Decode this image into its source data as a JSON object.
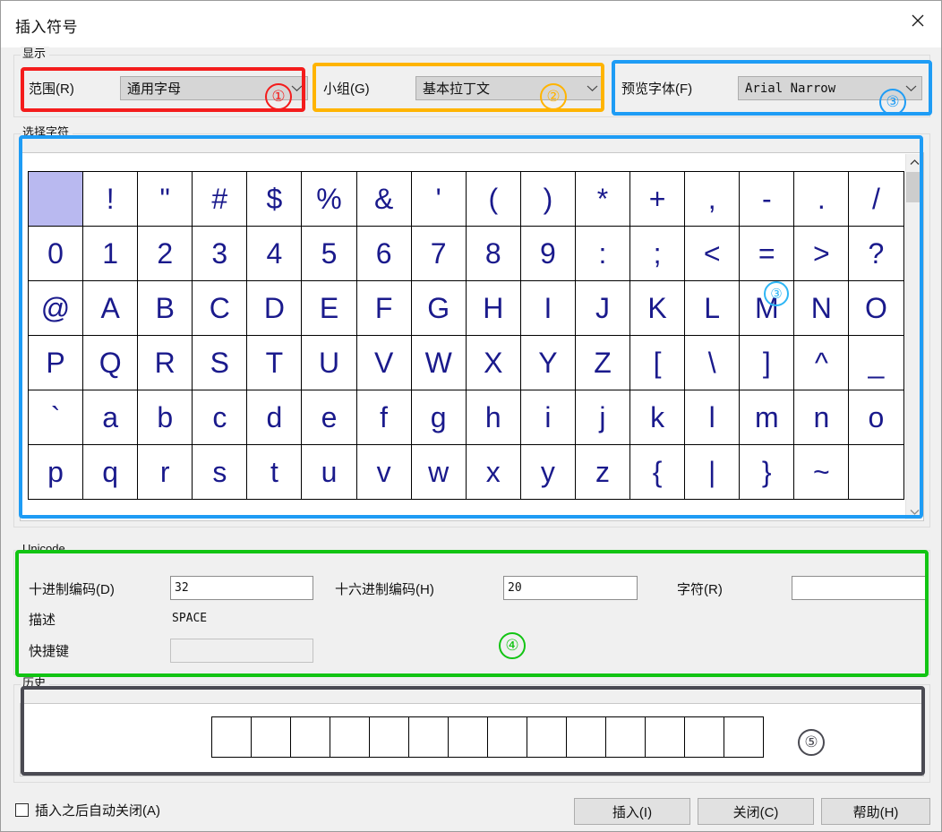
{
  "window": {
    "title": "插入符号",
    "close_icon": "close-icon"
  },
  "display_group": {
    "legend": "显示",
    "range_label": "范围(R)",
    "range_value": "通用字母",
    "subset_label": "小组(G)",
    "subset_value": "基本拉丁文",
    "font_label": "预览字体(F)",
    "font_value": "Arial Narrow"
  },
  "char_select_group": {
    "legend": "选择字符",
    "columns": 16,
    "selected_index": 0,
    "rows": [
      [
        " ",
        "!",
        "\"",
        "#",
        "$",
        "%",
        "&",
        "'",
        "(",
        ")",
        "*",
        "+",
        ",",
        "-",
        ".",
        "/"
      ],
      [
        "0",
        "1",
        "2",
        "3",
        "4",
        "5",
        "6",
        "7",
        "8",
        "9",
        ":",
        ";",
        "<",
        "=",
        ">",
        "?"
      ],
      [
        "@",
        "A",
        "B",
        "C",
        "D",
        "E",
        "F",
        "G",
        "H",
        "I",
        "J",
        "K",
        "L",
        "M",
        "N",
        "O"
      ],
      [
        "P",
        "Q",
        "R",
        "S",
        "T",
        "U",
        "V",
        "W",
        "X",
        "Y",
        "Z",
        "[",
        "\\",
        "]",
        "^",
        "_"
      ],
      [
        "`",
        "a",
        "b",
        "c",
        "d",
        "e",
        "f",
        "g",
        "h",
        "i",
        "j",
        "k",
        "l",
        "m",
        "n",
        "o"
      ],
      [
        "p",
        "q",
        "r",
        "s",
        "t",
        "u",
        "v",
        "w",
        "x",
        "y",
        "z",
        "{",
        "|",
        "}",
        "~",
        " "
      ]
    ],
    "scrollbar": {
      "up_icon": "chevron-up-icon",
      "down_icon": "chevron-down-icon"
    }
  },
  "unicode_group": {
    "legend": "Unicode",
    "decimal_label": "十进制编码(D)",
    "decimal_value": "32",
    "hex_label": "十六进制编码(H)",
    "hex_value": "20",
    "char_label": "字符(R)",
    "char_value": "",
    "description_label": "描述",
    "description_value": "SPACE",
    "shortcut_label": "快捷键",
    "shortcut_value": ""
  },
  "history_group": {
    "legend": "历史",
    "cell_count": 14,
    "cells": [
      "",
      "",
      "",
      "",
      "",
      "",
      "",
      "",
      "",
      "",
      "",
      "",
      "",
      ""
    ]
  },
  "footer": {
    "autoclose_label": "插入之后自动关闭(A)",
    "autoclose_checked": false,
    "insert_label": "插入(I)",
    "close_label": "关闭(C)",
    "help_label": "帮助(H)"
  },
  "annotations": {
    "colors": {
      "red": "#f41c1c",
      "orange": "#ffb400",
      "blue": "#1e9cf5",
      "green": "#12c413",
      "dark": "#4a4a52"
    },
    "markers": [
      {
        "id": "1",
        "label": "①",
        "color": "#f41c1c"
      },
      {
        "id": "2",
        "label": "②",
        "color": "#ffb400"
      },
      {
        "id": "3",
        "label": "③",
        "color": "#1e9cf5"
      },
      {
        "id": "3b",
        "label": "③",
        "color": "#2eb6f5"
      },
      {
        "id": "4",
        "label": "④",
        "color": "#12c413"
      },
      {
        "id": "5",
        "label": "⑤",
        "color": "#4a4a52"
      }
    ]
  }
}
